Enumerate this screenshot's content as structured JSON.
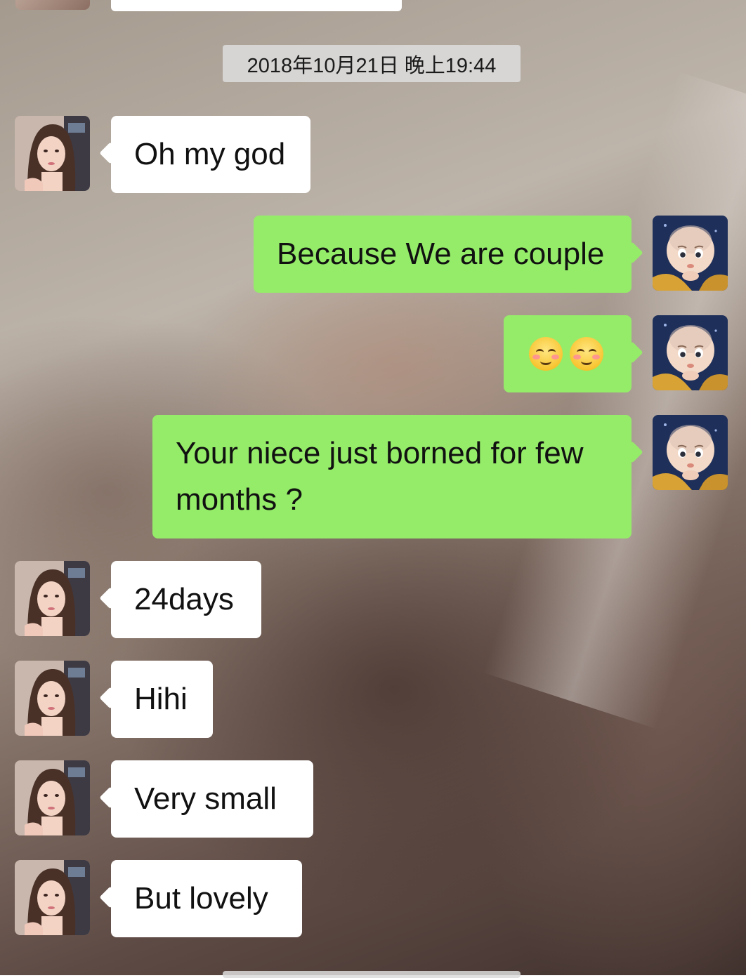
{
  "chat": {
    "timestamp": "2018年10月21日 晚上19:44",
    "messages": [
      {
        "side": "left",
        "text": "Oh my god"
      },
      {
        "side": "right",
        "text": "Because We are couple"
      },
      {
        "side": "right",
        "emoji": [
          "smiling-blush-emoji",
          "smiling-blush-emoji"
        ]
      },
      {
        "side": "right",
        "text": "Your niece just borned for few months ?"
      },
      {
        "side": "left",
        "text": "24days"
      },
      {
        "side": "left",
        "text": "Hihi"
      },
      {
        "side": "left",
        "text": "Very small"
      },
      {
        "side": "left",
        "text": "But lovely"
      }
    ]
  },
  "colors": {
    "sent_bubble": "#95ec69",
    "received_bubble": "#ffffff",
    "timestamp_bg": "#dcdcdc"
  }
}
